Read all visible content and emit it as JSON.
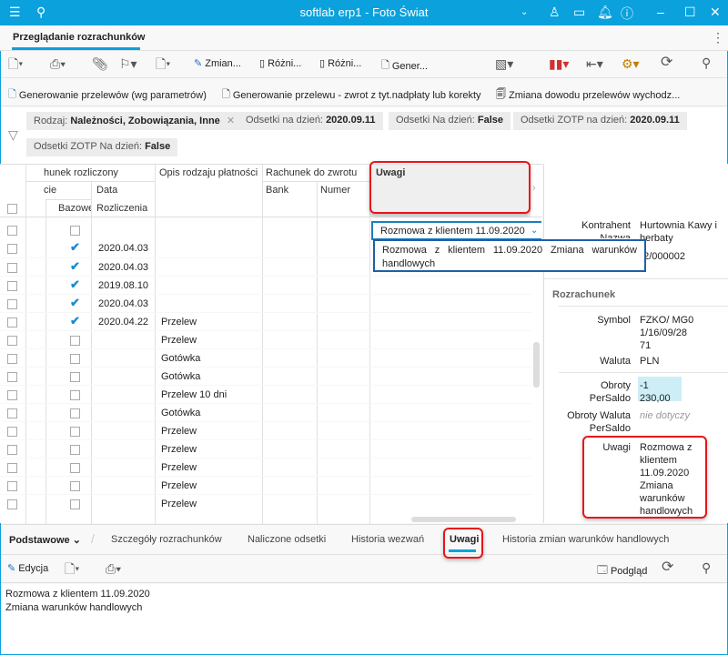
{
  "window": {
    "title": "softlab erp1 - Foto Świat"
  },
  "tab": {
    "label": "Przeglądanie rozrachunków"
  },
  "toolbar": {
    "zmiana": "Zmian...",
    "roznice1": "Różni...",
    "roznice2": "Różni...",
    "generuj": "Gener..."
  },
  "toolbar2": {
    "gen_params": "Generowanie przelewów (wg parametrów)",
    "gen_zwrot": "Generowanie przelewu - zwrot z tyt.nadpłaty lub korekty",
    "zmiana_dowodu": "Zmiana dowodu przelewów wychodz..."
  },
  "filters": [
    {
      "label": "Rodzaj:",
      "value": "Należności, Zobowiązania, Inne"
    },
    {
      "label": "Odsetki  na dzień:",
      "value": "2020.09.11"
    },
    {
      "label": "Odsetki  Na dzień:",
      "value": "False"
    },
    {
      "label": "Odsetki ZOTP  na dzień:",
      "value": "2020.09.11"
    },
    {
      "label": "Odsetki ZOTP  Na dzień:",
      "value": "False"
    }
  ],
  "grid": {
    "headers": {
      "rachunek_rozliczony": "hunek rozliczony",
      "cie": "cie",
      "bazowe": "Bazowe",
      "data": "Data",
      "rozliczenia": "Rozliczenia",
      "opis": "Opis rodzaju płatności",
      "rachunek_zwrotu": "Rachunek do zwrotu",
      "bank": "Bank",
      "numer": "Numer",
      "uwagi": "Uwagi"
    },
    "rows": [
      {
        "checked": false,
        "date": "",
        "opis": ""
      },
      {
        "checked": true,
        "date": "2020.04.03",
        "opis": ""
      },
      {
        "checked": true,
        "date": "2020.04.03",
        "opis": ""
      },
      {
        "checked": true,
        "date": "2019.08.10",
        "opis": ""
      },
      {
        "checked": true,
        "date": "2020.04.03",
        "opis": ""
      },
      {
        "checked": true,
        "date": "2020.04.22",
        "opis": "Przelew"
      },
      {
        "checked": false,
        "date": "",
        "opis": "Przelew"
      },
      {
        "checked": false,
        "date": "",
        "opis": "Gotówka"
      },
      {
        "checked": false,
        "date": "",
        "opis": "Gotówka"
      },
      {
        "checked": false,
        "date": "",
        "opis": "Przelew 10 dni"
      },
      {
        "checked": false,
        "date": "",
        "opis": "Gotówka"
      },
      {
        "checked": false,
        "date": "",
        "opis": "Przelew"
      },
      {
        "checked": false,
        "date": "",
        "opis": "Przelew"
      },
      {
        "checked": false,
        "date": "",
        "opis": "Przelew"
      },
      {
        "checked": false,
        "date": "",
        "opis": "Przelew"
      },
      {
        "checked": false,
        "date": "",
        "opis": "Przelew"
      }
    ],
    "uwagi_combo": "Rozmowa z klientem 11.09.2020",
    "uwagi_tooltip": "Rozmowa z klientem 11.09.2020 Zmiana warunków handlowych"
  },
  "side": {
    "kontrahent_label": "Kontrahent",
    "kontrahent_value": "Hurtownia Kawy i herbaty",
    "nazwa_label": "Nazwa",
    "nr_value": "02/000002",
    "section": "Rozrachunek",
    "symbol_label": "Symbol",
    "symbol_value": "FZKO/ MG01/16/09/28 71",
    "waluta_label": "Waluta",
    "waluta_value": "PLN",
    "obroty_label": "Obroty PerSaldo",
    "obroty_value": "-1 230,00",
    "obroty_wal_label": "Obroty Waluta PerSaldo",
    "obroty_wal_value": "nie dotyczy",
    "uwagi_label": "Uwagi",
    "uwagi_value": "Rozmowa z klientem 11.09.2020 Zmiana warunków handlowych"
  },
  "bottom_tabs": {
    "group": "Podstawowe",
    "tabs": [
      "Szczegóły rozrachunków",
      "Naliczone odsetki",
      "Historia wezwań",
      "Uwagi",
      "Historia zmian warunków handlowych"
    ],
    "active": "Uwagi"
  },
  "bottom_toolbar": {
    "edycja": "Edycja",
    "podglad": "Podgląd"
  },
  "notes": {
    "line1": "Rozmowa z klientem 11.09.2020",
    "line2": "Zmiana warunków handlowych"
  },
  "colors": {
    "accent": "#0aa1dd",
    "highlight": "#e8141a",
    "saldo_bg": "#cdeef6"
  }
}
